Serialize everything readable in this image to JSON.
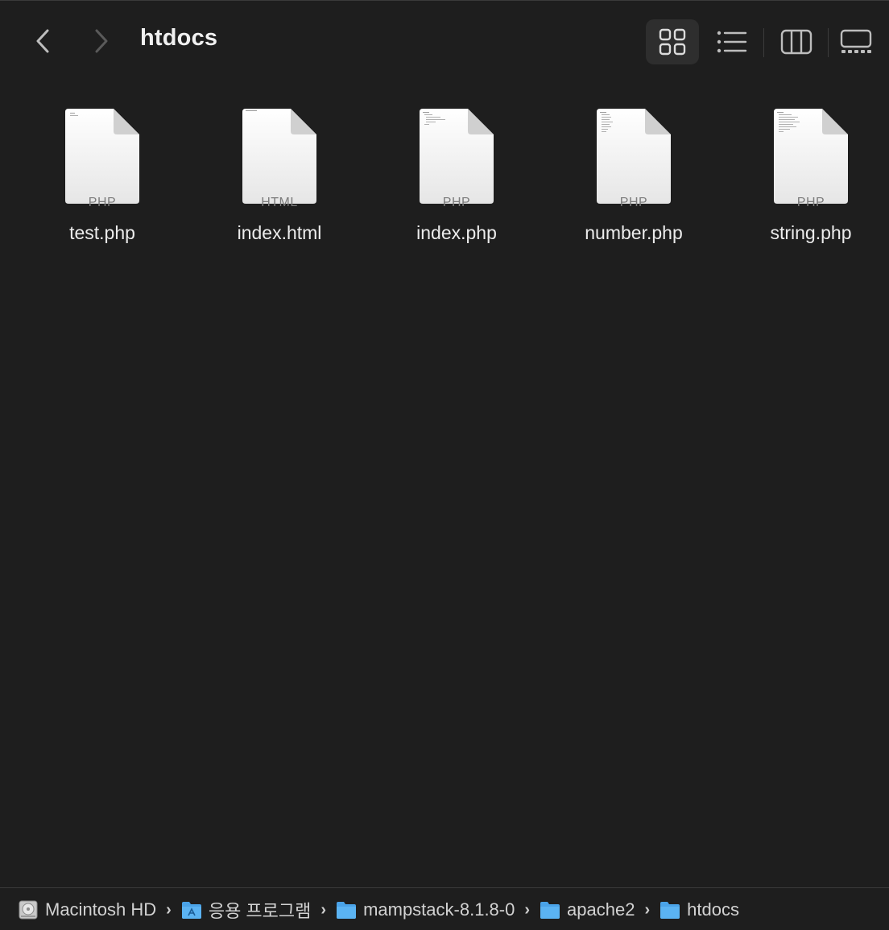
{
  "window": {
    "title": "htdocs"
  },
  "toolbar": {
    "back_icon": "chevron-left-icon",
    "forward_icon": "chevron-right-icon",
    "views": [
      {
        "name": "icon-view",
        "icon": "grid-icon",
        "active": true
      },
      {
        "name": "list-view",
        "icon": "list-icon",
        "active": false
      },
      {
        "name": "column-view",
        "icon": "columns-icon",
        "active": false
      },
      {
        "name": "gallery-view",
        "icon": "gallery-icon",
        "active": false
      }
    ]
  },
  "files": [
    {
      "name": "test.php",
      "type": "PHP"
    },
    {
      "name": "index.html",
      "type": "HTML"
    },
    {
      "name": "index.php",
      "type": "PHP"
    },
    {
      "name": "number.php",
      "type": "PHP"
    },
    {
      "name": "string.php",
      "type": "PHP"
    }
  ],
  "pathbar": {
    "items": [
      {
        "label": "Macintosh HD",
        "icon": "hard-drive-icon"
      },
      {
        "label": "응용 프로그램",
        "icon": "applications-folder-icon"
      },
      {
        "label": "mampstack-8.1.8-0",
        "icon": "folder-icon"
      },
      {
        "label": "apache2",
        "icon": "folder-icon"
      },
      {
        "label": "htdocs",
        "icon": "folder-icon"
      }
    ],
    "separator": "›"
  },
  "colors": {
    "background": "#1e1e1e",
    "folder_blue": "#4aa3e8",
    "active_view_bg": "#2e2e2e"
  }
}
